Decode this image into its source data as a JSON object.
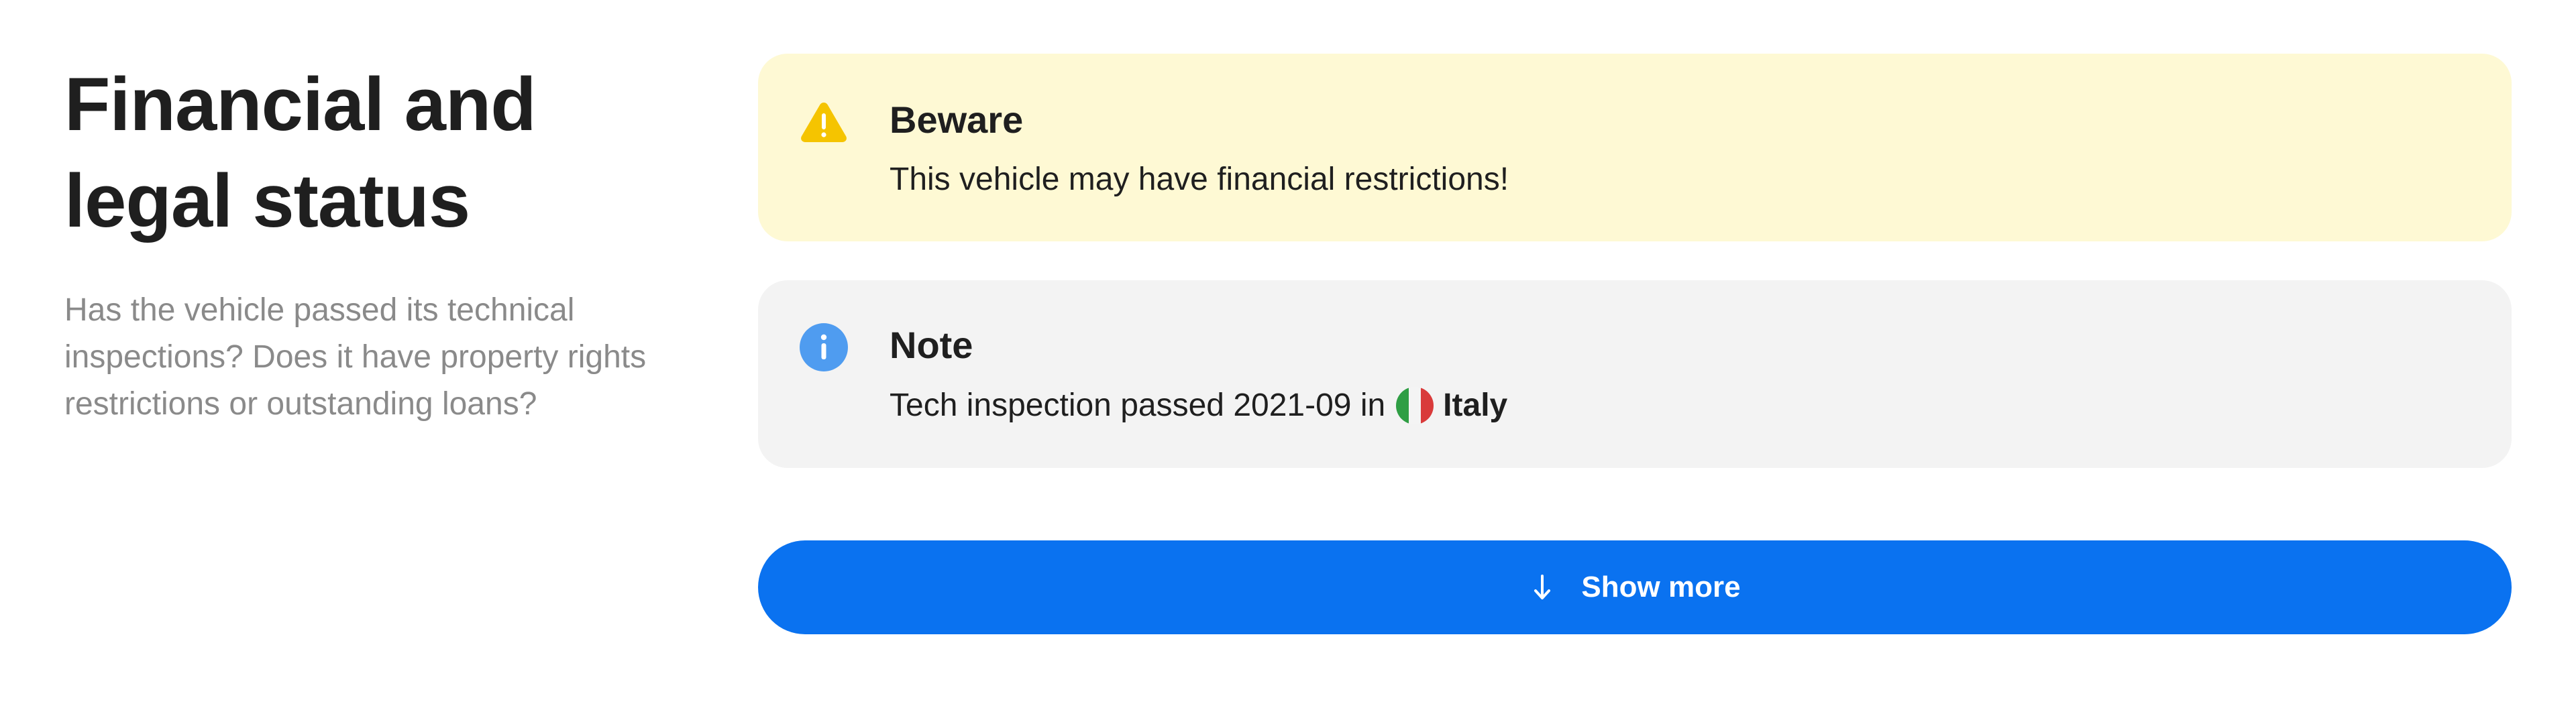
{
  "section": {
    "title_line1": "Financial and",
    "title_line2": "legal status",
    "description": "Has the vehicle passed its technical inspections? Does it have property rights restrictions or outstanding loans?"
  },
  "warning_card": {
    "icon": "warning-triangle-icon",
    "title": "Beware",
    "text": "This vehicle may have financial restrictions!",
    "bg_color": "#fef9d4",
    "icon_color": "#f5c400"
  },
  "info_card": {
    "icon": "info-circle-icon",
    "title": "Note",
    "text_prefix": "Tech inspection passed 2021-09 in",
    "country_flag": "italy-flag-icon",
    "country": "Italy",
    "bg_color": "#f3f3f3",
    "icon_color": "#4f9cf0"
  },
  "show_more": {
    "label": "Show more",
    "icon": "arrow-down-icon",
    "color": "#0a72f0"
  }
}
